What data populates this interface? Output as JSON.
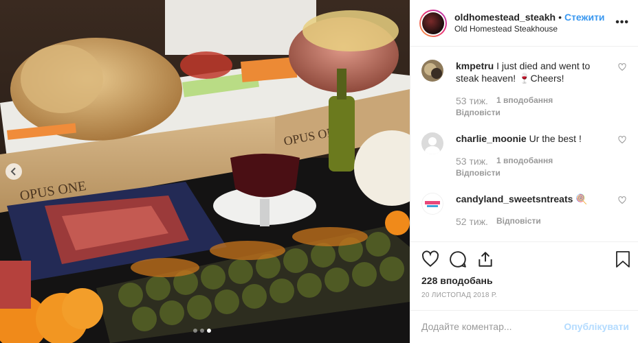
{
  "photo": {
    "carousel_dots": 3,
    "active_dot": 2,
    "crate_labels": [
      "OPUS ONE",
      "OPUS ONE"
    ]
  },
  "header": {
    "username": "oldhomestead_steakh",
    "separator": "•",
    "follow_label": "Стежити",
    "location": "Old Homestead Steakhouse",
    "more_label": "•••"
  },
  "comments": [
    {
      "username": "kmpetru",
      "text": "I just died and went to steak heaven! 🍷Cheers!",
      "time": "53 тиж.",
      "likes": "1 вподобання",
      "reply": "Відповісти"
    },
    {
      "username": "charlie_moonie",
      "text": "Ur the best !",
      "time": "53 тиж.",
      "likes": "1 вподобання",
      "reply": "Відповісти"
    },
    {
      "username": "candyland_sweetsntreats",
      "text": "🍭",
      "time": "52 тиж.",
      "reply": "Відповісти"
    }
  ],
  "actions": {
    "likes_count": "228 вподобань",
    "date": "20 ЛИСТОПАД 2018 Р."
  },
  "add_comment": {
    "placeholder": "Додайте коментар...",
    "post_label": "Опублікувати"
  },
  "colors": {
    "accent": "#3897f0",
    "post_disabled": "#b3dbff",
    "muted": "#999999"
  }
}
